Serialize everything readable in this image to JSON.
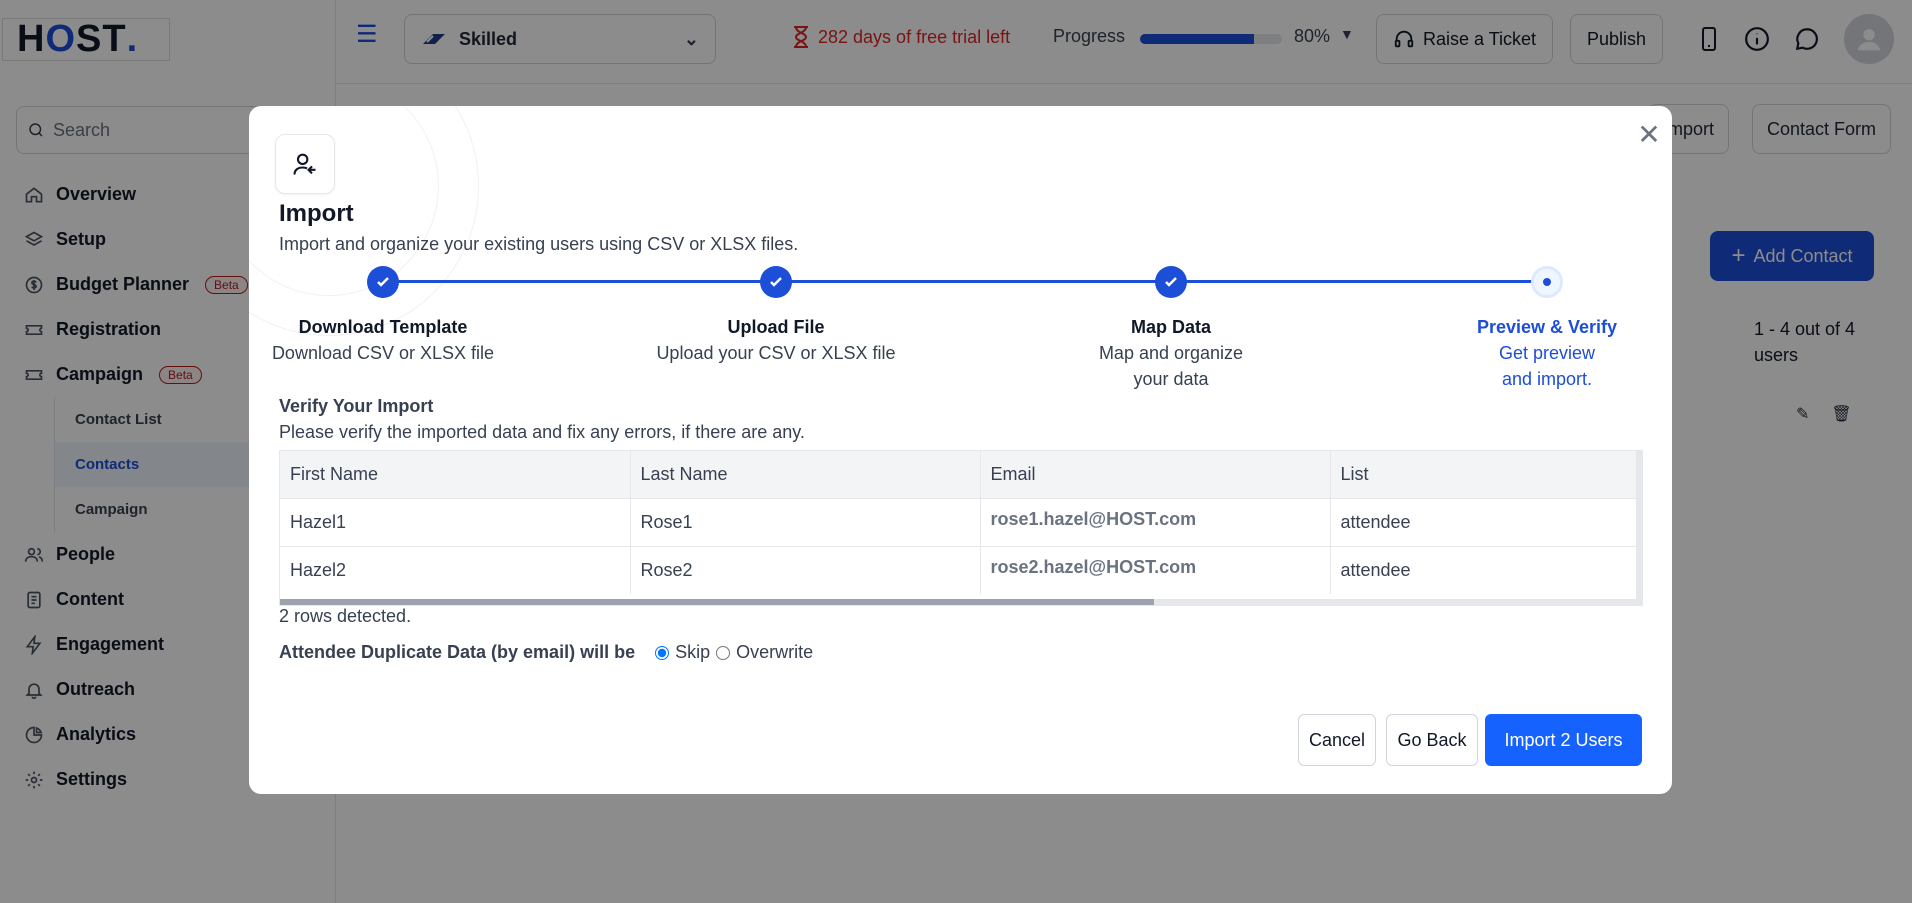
{
  "brand": {
    "logo_text_h": "H",
    "logo_text_o": "O",
    "logo_text_st": "ST",
    "logo_dot": "."
  },
  "sidebar": {
    "search_placeholder": "Search",
    "items": [
      {
        "label": "Overview",
        "icon": "home-icon"
      },
      {
        "label": "Setup",
        "icon": "layers-icon"
      },
      {
        "label": "Budget Planner",
        "icon": "dollar-icon",
        "badge": "Beta"
      },
      {
        "label": "Registration",
        "icon": "ticket-icon"
      },
      {
        "label": "Campaign",
        "icon": "ticket-icon",
        "badge": "Beta"
      }
    ],
    "campaign_sub": [
      "Contact List",
      "Contacts",
      "Campaign"
    ],
    "items_after": [
      {
        "label": "People",
        "icon": "users-icon"
      },
      {
        "label": "Content",
        "icon": "document-icon"
      },
      {
        "label": "Engagement",
        "icon": "bolt-icon"
      },
      {
        "label": "Outreach",
        "icon": "bell-icon"
      },
      {
        "label": "Analytics",
        "icon": "pie-chart-icon"
      },
      {
        "label": "Settings",
        "icon": "gear-icon"
      }
    ]
  },
  "topbar": {
    "event_name": "Skilled",
    "trial_text": "282 days of free trial left",
    "progress_label": "Progress",
    "progress_value": 0.8,
    "progress_pct": "80%",
    "raise_ticket": "Raise a Ticket",
    "publish": "Publish"
  },
  "main": {
    "import_btn": "Import",
    "contact_form_btn": "Contact Form",
    "add_contact": "Add Contact",
    "pager": "1 - 4 out of 4 users"
  },
  "modal": {
    "title": "Import",
    "description": "Import and organize your existing users using CSV or XLSX files.",
    "steps": [
      {
        "title": "Download Template",
        "desc": "Download CSV or XLSX file",
        "state": "done"
      },
      {
        "title": "Upload File",
        "desc": "Upload your CSV or XLSX file",
        "state": "done"
      },
      {
        "title": "Map Data",
        "desc": "Map and organize your data",
        "state": "done"
      },
      {
        "title": "Preview & Verify",
        "desc": "Get preview and import.",
        "state": "current"
      }
    ],
    "verify_title": "Verify Your Import",
    "verify_desc": "Please verify the imported data and fix any errors, if there are any.",
    "table": {
      "headers": [
        "First Name",
        "Last Name",
        "Email",
        "List"
      ],
      "rows": [
        [
          "Hazel1",
          "Rose1",
          "rose1.hazel@HOST.com",
          "attendee"
        ],
        [
          "Hazel2",
          "Rose2",
          "rose2.hazel@HOST.com",
          "attendee"
        ]
      ]
    },
    "rows_detected": "2 rows detected.",
    "duplicate_label": "Attendee Duplicate Data (by email) will be",
    "option_skip": "Skip",
    "option_overwrite": "Overwrite",
    "cancel": "Cancel",
    "go_back": "Go Back",
    "import_btn": "Import 2 Users"
  }
}
